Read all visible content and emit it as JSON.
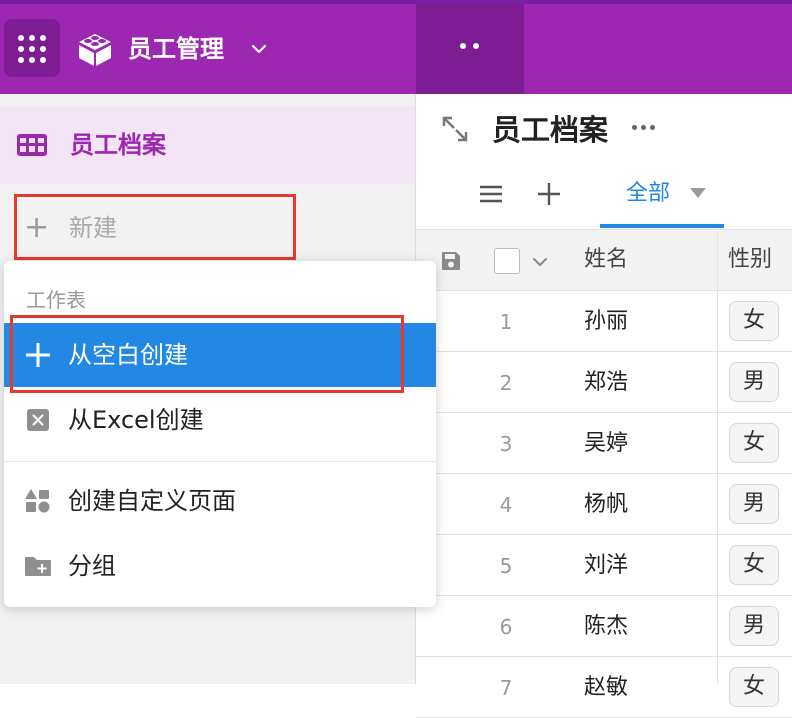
{
  "app": {
    "title": "员工管理",
    "brand_color": "#9c27b0"
  },
  "sidebar": {
    "sheet_label": "员工档案",
    "new_label": "新建"
  },
  "menu": {
    "header": "工作表",
    "items": [
      {
        "label": "从空白创建",
        "icon": "plus-icon",
        "selected": true
      },
      {
        "label": "从Excel创建",
        "icon": "excel-icon"
      },
      {
        "label": "创建自定义页面",
        "icon": "shapes-icon"
      },
      {
        "label": "分组",
        "icon": "folder-add-icon"
      }
    ],
    "selected_color": "#2288e3"
  },
  "main": {
    "sheet_title": "员工档案",
    "view_tab": "全部"
  },
  "table": {
    "columns": [
      "姓名",
      "性别"
    ],
    "rows": [
      {
        "num": "1",
        "name": "孙丽",
        "gender": "女"
      },
      {
        "num": "2",
        "name": "郑浩",
        "gender": "男"
      },
      {
        "num": "3",
        "name": "吴婷",
        "gender": "女"
      },
      {
        "num": "4",
        "name": "杨帆",
        "gender": "男"
      },
      {
        "num": "5",
        "name": "刘洋",
        "gender": "女"
      },
      {
        "num": "6",
        "name": "陈杰",
        "gender": "男"
      },
      {
        "num": "7",
        "name": "赵敏",
        "gender": "女"
      }
    ]
  }
}
